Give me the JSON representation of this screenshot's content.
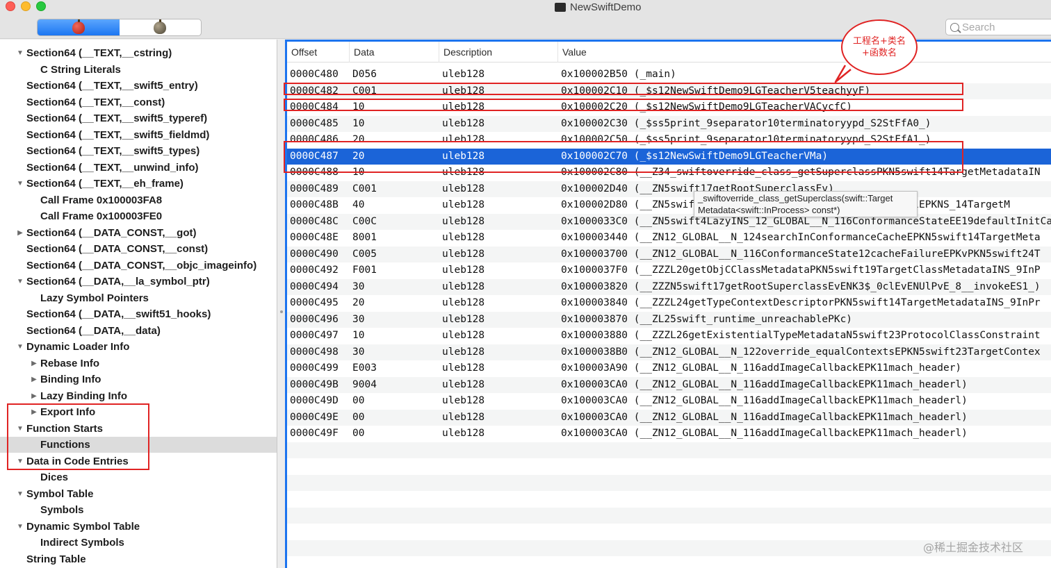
{
  "window": {
    "title": "NewSwiftDemo"
  },
  "toolbar": {
    "search_placeholder": "Search"
  },
  "sidebar": {
    "items": [
      {
        "label": "Section64 (__TEXT,__cstring)",
        "indent": 1,
        "disclosure": "open"
      },
      {
        "label": "C String Literals",
        "indent": 2,
        "disclosure": "none"
      },
      {
        "label": "Section64 (__TEXT,__swift5_entry)",
        "indent": 1,
        "disclosure": "none"
      },
      {
        "label": "Section64 (__TEXT,__const)",
        "indent": 1,
        "disclosure": "none"
      },
      {
        "label": "Section64 (__TEXT,__swift5_typeref)",
        "indent": 1,
        "disclosure": "none"
      },
      {
        "label": "Section64 (__TEXT,__swift5_fieldmd)",
        "indent": 1,
        "disclosure": "none"
      },
      {
        "label": "Section64 (__TEXT,__swift5_types)",
        "indent": 1,
        "disclosure": "none"
      },
      {
        "label": "Section64 (__TEXT,__unwind_info)",
        "indent": 1,
        "disclosure": "none"
      },
      {
        "label": "Section64 (__TEXT,__eh_frame)",
        "indent": 1,
        "disclosure": "open"
      },
      {
        "label": "Call Frame 0x100003FA8",
        "indent": 2,
        "disclosure": "none"
      },
      {
        "label": "Call Frame 0x100003FE0",
        "indent": 2,
        "disclosure": "none"
      },
      {
        "label": "Section64 (__DATA_CONST,__got)",
        "indent": 1,
        "disclosure": "closed"
      },
      {
        "label": "Section64 (__DATA_CONST,__const)",
        "indent": 1,
        "disclosure": "none"
      },
      {
        "label": "Section64 (__DATA_CONST,__objc_imageinfo)",
        "indent": 1,
        "disclosure": "none"
      },
      {
        "label": "Section64 (__DATA,__la_symbol_ptr)",
        "indent": 1,
        "disclosure": "open"
      },
      {
        "label": "Lazy Symbol Pointers",
        "indent": 2,
        "disclosure": "none"
      },
      {
        "label": "Section64 (__DATA,__swift51_hooks)",
        "indent": 1,
        "disclosure": "none"
      },
      {
        "label": "Section64 (__DATA,__data)",
        "indent": 1,
        "disclosure": "none"
      },
      {
        "label": "Dynamic Loader Info",
        "indent": 1,
        "disclosure": "open"
      },
      {
        "label": "Rebase Info",
        "indent": 2,
        "disclosure": "closed"
      },
      {
        "label": "Binding Info",
        "indent": 2,
        "disclosure": "closed"
      },
      {
        "label": "Lazy Binding Info",
        "indent": 2,
        "disclosure": "closed"
      },
      {
        "label": "Export Info",
        "indent": 2,
        "disclosure": "closed"
      },
      {
        "label": "Function Starts",
        "indent": 1,
        "disclosure": "open"
      },
      {
        "label": "Functions",
        "indent": 2,
        "disclosure": "none",
        "selected": true
      },
      {
        "label": "Data in Code Entries",
        "indent": 1,
        "disclosure": "open"
      },
      {
        "label": "Dices",
        "indent": 2,
        "disclosure": "none"
      },
      {
        "label": "Symbol Table",
        "indent": 1,
        "disclosure": "open"
      },
      {
        "label": "Symbols",
        "indent": 2,
        "disclosure": "none"
      },
      {
        "label": "Dynamic Symbol Table",
        "indent": 1,
        "disclosure": "open"
      },
      {
        "label": "Indirect Symbols",
        "indent": 2,
        "disclosure": "none"
      },
      {
        "label": "String Table",
        "indent": 1,
        "disclosure": "none"
      }
    ]
  },
  "table": {
    "columns": [
      "Offset",
      "Data",
      "Description",
      "Value"
    ],
    "selected_index": 5,
    "rows": [
      [
        "0000C480",
        "D056",
        "uleb128",
        "0x100002B50 (_main)"
      ],
      [
        "0000C482",
        "C001",
        "uleb128",
        "0x100002C10 (_$s12NewSwiftDemo9LGTeacherV5teachyyF)"
      ],
      [
        "0000C484",
        "10",
        "uleb128",
        "0x100002C20 (_$s12NewSwiftDemo9LGTeacherVACycfC)"
      ],
      [
        "0000C485",
        "10",
        "uleb128",
        "0x100002C30 (_$ss5print_9separator10terminatoryypd_S2StFfA0_)"
      ],
      [
        "0000C486",
        "20",
        "uleb128",
        "0x100002C50 (_$ss5print_9separator10terminatoryypd_S2StFfA1_)"
      ],
      [
        "0000C487",
        "20",
        "uleb128",
        "0x100002C70 (_$s12NewSwiftDemo9LGTeacherVMa)"
      ],
      [
        "0000C488",
        "10",
        "uleb128",
        "0x100002C80 (__Z34_swiftoverride_class_getSuperclassPKN5swift14TargetMetadataIN"
      ],
      [
        "0000C489",
        "C001",
        "uleb128",
        "0x100002D40 (__ZN5swift17getRootSuperclassEv)"
      ],
      [
        "0000C48B",
        "40",
        "uleb128",
        "0x100002D80 (__ZN5swift34swift50override_conformsToProtocolEPKNS_14TargetM"
      ],
      [
        "0000C48C",
        "C00C",
        "uleb128",
        "0x1000033C0 (__ZN5swift4LazyINS_12_GLOBAL__N_116ConformanceStateEE19defaultInitCa"
      ],
      [
        "0000C48E",
        "8001",
        "uleb128",
        "0x100003440 (__ZN12_GLOBAL__N_124searchInConformanceCacheEPKN5swift14TargetMeta"
      ],
      [
        "0000C490",
        "C005",
        "uleb128",
        "0x100003700 (__ZN12_GLOBAL__N_116ConformanceState12cacheFailureEPKvPKN5swift24T"
      ],
      [
        "0000C492",
        "F001",
        "uleb128",
        "0x1000037F0 (__ZZZL20getObjCClassMetadataPKN5swift19TargetClassMetadataINS_9InP"
      ],
      [
        "0000C494",
        "30",
        "uleb128",
        "0x100003820 (__ZZZN5swift17getRootSuperclassEvENK3$_0clEvENUlPvE_8__invokeES1_)"
      ],
      [
        "0000C495",
        "20",
        "uleb128",
        "0x100003840 (__ZZZL24getTypeContextDescriptorPKN5swift14TargetMetadataINS_9InPr"
      ],
      [
        "0000C496",
        "30",
        "uleb128",
        "0x100003870 (__ZL25swift_runtime_unreachablePKc)"
      ],
      [
        "0000C497",
        "10",
        "uleb128",
        "0x100003880 (__ZZZL26getExistentialTypeMetadataN5swift23ProtocolClassConstraint"
      ],
      [
        "0000C498",
        "30",
        "uleb128",
        "0x1000038B0 (__ZN12_GLOBAL__N_122override_equalContextsEPKN5swift23TargetContex"
      ],
      [
        "0000C499",
        "E003",
        "uleb128",
        "0x100003A90 (__ZN12_GLOBAL__N_116addImageCallbackEPK11mach_header)"
      ],
      [
        "0000C49B",
        "9004",
        "uleb128",
        "0x100003CA0 (__ZN12_GLOBAL__N_116addImageCallbackEPK11mach_headerl)"
      ],
      [
        "0000C49D",
        "00",
        "uleb128",
        "0x100003CA0 (__ZN12_GLOBAL__N_116addImageCallbackEPK11mach_headerl)"
      ],
      [
        "0000C49E",
        "00",
        "uleb128",
        "0x100003CA0 (__ZN12_GLOBAL__N_116addImageCallbackEPK11mach_headerl)"
      ],
      [
        "0000C49F",
        "00",
        "uleb128",
        "0x100003CA0 (__ZN12_GLOBAL__N_116addImageCallbackEPK11mach_headerl)"
      ]
    ]
  },
  "tooltip": {
    "line1": "_swiftoverride_class_getSuperclass(swift::Target",
    "line2": "Metadata<swift::InProcess> const*)"
  },
  "annotation": {
    "line1": "工程名+类名",
    "line2": "+函数名"
  },
  "watermark": "@稀土掘金技术社区",
  "colors": {
    "selection": "#1b64d8",
    "annotation": "#e02323",
    "focus_ring": "#1c74ef"
  }
}
